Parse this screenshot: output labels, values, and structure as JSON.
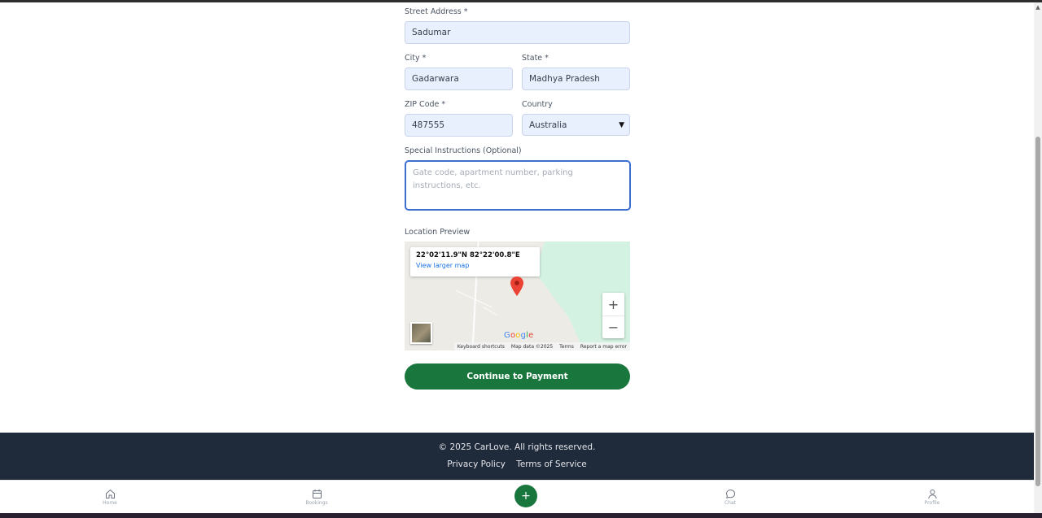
{
  "form": {
    "street_label": "Street Address *",
    "street_value": "Sadumar",
    "city_label": "City *",
    "city_value": "Gadarwara",
    "state_label": "State *",
    "state_value": "Madhya Pradesh",
    "zip_label": "ZIP Code *",
    "zip_value": "487555",
    "country_label": "Country",
    "country_value": "Australia",
    "instructions_label": "Special Instructions (Optional)",
    "instructions_placeholder": "Gate code, apartment number, parking instructions, etc.",
    "map_label": "Location Preview",
    "continue_label": "Continue to Payment"
  },
  "map": {
    "coordinates": "22°02'11.9\"N 82°22'00.8\"E",
    "larger_map": "View larger map",
    "zoom_in": "+",
    "zoom_out": "−",
    "attribution": {
      "shortcuts": "Keyboard shortcuts",
      "data": "Map data ©2025",
      "terms": "Terms",
      "report": "Report a map error"
    },
    "google_letters": [
      {
        "char": "G",
        "color": "#4285f4"
      },
      {
        "char": "o",
        "color": "#ea4335"
      },
      {
        "char": "o",
        "color": "#fbbc05"
      },
      {
        "char": "g",
        "color": "#4285f4"
      },
      {
        "char": "l",
        "color": "#34a853"
      },
      {
        "char": "e",
        "color": "#ea4335"
      }
    ]
  },
  "footer": {
    "copyright": "© 2025 CarLove. All rights reserved.",
    "privacy": "Privacy Policy",
    "terms": "Terms of Service"
  },
  "nav": {
    "home": "Home",
    "bookings": "Bookings",
    "add": "+",
    "chat": "Chat",
    "profile": "Profile"
  },
  "colors": {
    "accent": "#19763d",
    "footer_bg": "#1f2a3b",
    "input_bg": "#e8effd",
    "focus_border": "#3b6fd6"
  }
}
